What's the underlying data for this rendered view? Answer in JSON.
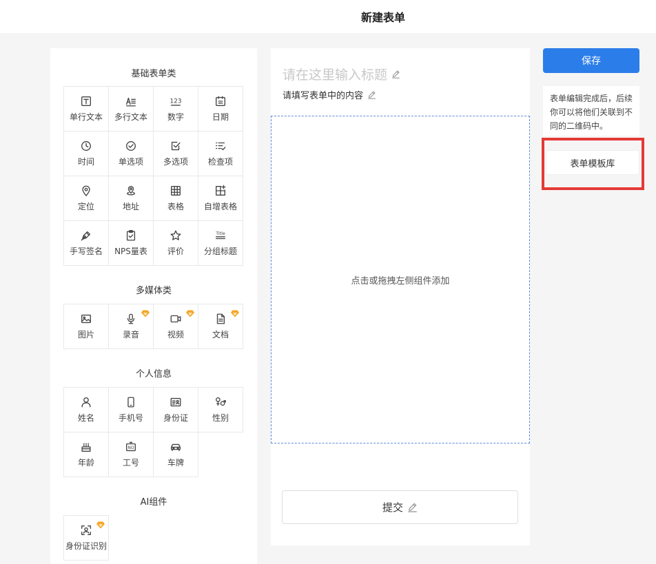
{
  "header": {
    "title": "新建表单"
  },
  "sections": [
    {
      "title": "基础表单类",
      "items": [
        {
          "label": "单行文本",
          "icon": "text-t-icon"
        },
        {
          "label": "多行文本",
          "icon": "multiline-text-icon"
        },
        {
          "label": "数字",
          "icon": "number-icon"
        },
        {
          "label": "日期",
          "icon": "calendar-icon"
        },
        {
          "label": "时间",
          "icon": "clock-icon"
        },
        {
          "label": "单选项",
          "icon": "radio-check-icon"
        },
        {
          "label": "多选项",
          "icon": "checkbox-icon"
        },
        {
          "label": "检查项",
          "icon": "checklist-icon"
        },
        {
          "label": "定位",
          "icon": "location-pin-icon"
        },
        {
          "label": "地址",
          "icon": "address-pin-icon"
        },
        {
          "label": "表格",
          "icon": "table-icon"
        },
        {
          "label": "自增表格",
          "icon": "table-add-icon"
        },
        {
          "label": "手写签名",
          "icon": "pen-nib-icon"
        },
        {
          "label": "NPS量表",
          "icon": "clipboard-check-icon"
        },
        {
          "label": "评价",
          "icon": "star-icon"
        },
        {
          "label": "分组标题",
          "icon": "title-icon",
          "icon_text": "Title"
        }
      ]
    },
    {
      "title": "多媒体类",
      "items": [
        {
          "label": "图片",
          "icon": "image-icon"
        },
        {
          "label": "录音",
          "icon": "microphone-icon",
          "vip": true
        },
        {
          "label": "视频",
          "icon": "video-icon",
          "vip": true
        },
        {
          "label": "文档",
          "icon": "document-icon",
          "vip": true
        }
      ]
    },
    {
      "title": "个人信息",
      "items": [
        {
          "label": "姓名",
          "icon": "person-icon"
        },
        {
          "label": "手机号",
          "icon": "phone-icon"
        },
        {
          "label": "身份证",
          "icon": "id-card-icon"
        },
        {
          "label": "性别",
          "icon": "gender-icon"
        },
        {
          "label": "年龄",
          "icon": "cake-icon"
        },
        {
          "label": "工号",
          "icon": "badge-no-icon",
          "icon_text": "NO"
        },
        {
          "label": "车牌",
          "icon": "car-icon"
        }
      ]
    },
    {
      "title": "AI组件",
      "items": [
        {
          "label": "身份证识别",
          "icon": "id-scan-icon",
          "vip": true
        }
      ]
    }
  ],
  "form": {
    "title_placeholder": "请在这里输入标题",
    "description": "请填写表单中的内容",
    "dropzone_hint": "点击或拖拽左侧组件添加",
    "submit_label": "提交"
  },
  "sidebar": {
    "save_label": "保存",
    "info_text": "表单编辑完成后，后续你可以将他们关联到不同的二维码中。",
    "template_label": "表单模板库"
  },
  "colors": {
    "primary": "#2b7de9",
    "highlight": "#e53935",
    "vip": "#f5a623",
    "dropzone_border": "#5b8bd6"
  }
}
